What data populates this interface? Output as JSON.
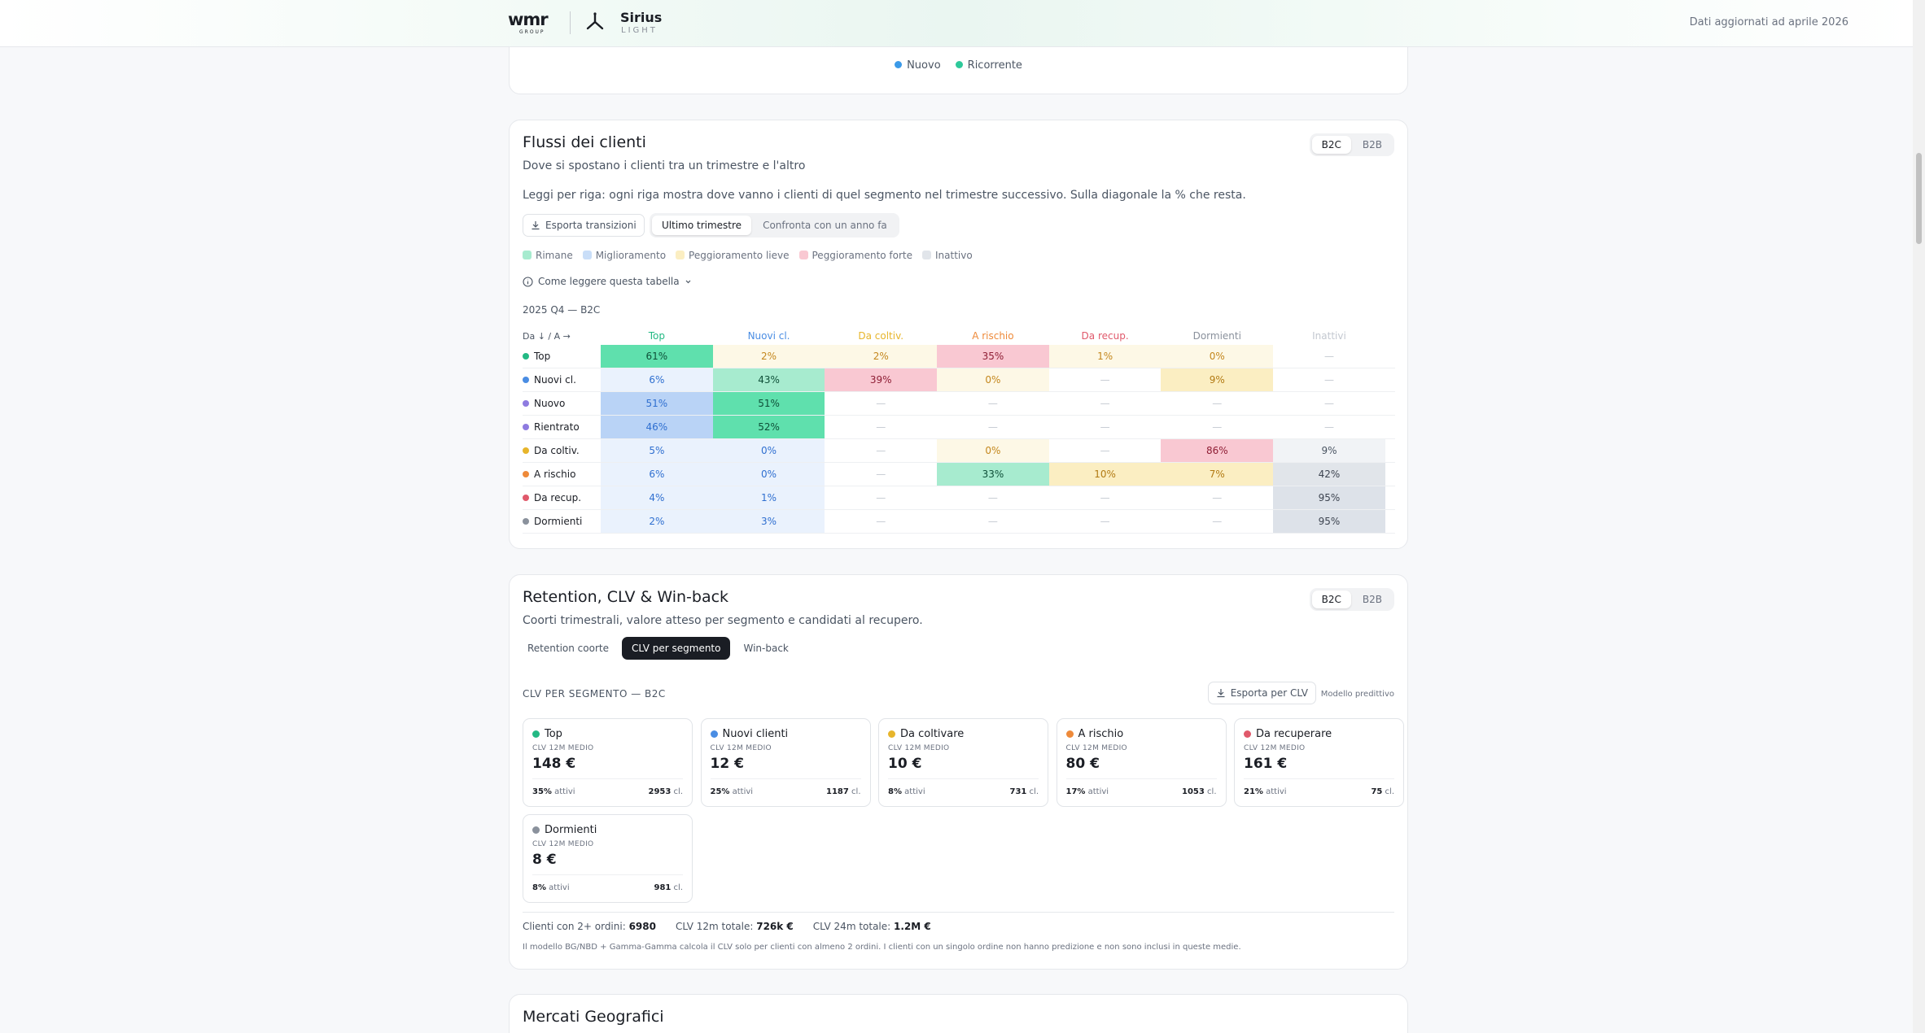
{
  "header": {
    "logo_text": "wmr",
    "logo_sub": "GROUP",
    "app_name": "Sirius",
    "app_sub": "LIGHT",
    "updated": "Dati aggiornati ad aprile 2026"
  },
  "top_legend": [
    {
      "label": "Nuovo",
      "color": "#3b9ae8"
    },
    {
      "label": "Ricorrente",
      "color": "#2ec99a"
    }
  ],
  "flussi": {
    "title": "Flussi dei clienti",
    "subtitle": "Dove si spostano i clienti tra un trimestre e l'altro",
    "toggle": [
      "B2C",
      "B2B"
    ],
    "toggle_active": "B2C",
    "info": "Leggi per riga: ogni riga mostra dove vanno i clienti di quel segmento nel trimestre successivo. Sulla diagonale la % che resta.",
    "export_label": "Esporta transizioni",
    "tabs": [
      "Ultimo trimestre",
      "Confronta con un anno fa"
    ],
    "tab_active": "Ultimo trimestre",
    "legend": [
      {
        "label": "Rimane",
        "color": "#a7ebcf"
      },
      {
        "label": "Miglioramento",
        "color": "#c9def8"
      },
      {
        "label": "Peggioramento lieve",
        "color": "#fbeec2"
      },
      {
        "label": "Peggioramento forte",
        "color": "#f9c8d2"
      },
      {
        "label": "Inattivo",
        "color": "#e1e5ea"
      }
    ],
    "howto": "Come leggere questa tabella",
    "period": "2025 Q4 — B2C",
    "corner": "Da ↓ / A →",
    "columns": [
      {
        "label": "Top",
        "color": "#23b984"
      },
      {
        "label": "Nuovi cl.",
        "color": "#4a8de3"
      },
      {
        "label": "Da coltiv.",
        "color": "#e7b52b"
      },
      {
        "label": "A rischio",
        "color": "#ee8a3a"
      },
      {
        "label": "Da recup.",
        "color": "#e0596b"
      },
      {
        "label": "Dormienti",
        "color": "#8a919c"
      },
      {
        "label": "Inattivi",
        "color": "#c3c8d0"
      }
    ],
    "rows": [
      {
        "label": "Top",
        "dot": "#23b984",
        "cells": [
          {
            "v": "61%",
            "bg": "#5fe0ad",
            "fg": "#0e4f38"
          },
          {
            "v": "2%",
            "bg": "#fdf8e6",
            "fg": "#c4871d"
          },
          {
            "v": "2%",
            "bg": "#fdf8e6",
            "fg": "#c4871d"
          },
          {
            "v": "35%",
            "bg": "#f9c8d2",
            "fg": "#8f1e35"
          },
          {
            "v": "1%",
            "bg": "#fdf8e6",
            "fg": "#c4871d"
          },
          {
            "v": "0%",
            "bg": "#fdf8e6",
            "fg": "#c4871d"
          },
          {
            "v": "—",
            "bg": "",
            "fg": "#c3c8d0"
          }
        ]
      },
      {
        "label": "Nuovi cl.",
        "dot": "#4a8de3",
        "cells": [
          {
            "v": "6%",
            "bg": "#eaf2fd",
            "fg": "#2f6fd0"
          },
          {
            "v": "43%",
            "bg": "#a7ebcf",
            "fg": "#0e4f38"
          },
          {
            "v": "39%",
            "bg": "#f9c8d2",
            "fg": "#8f1e35"
          },
          {
            "v": "0%",
            "bg": "#fdf8e6",
            "fg": "#c4871d"
          },
          {
            "v": "—",
            "bg": "",
            "fg": "#c3c8d0"
          },
          {
            "v": "9%",
            "bg": "#fbeec2",
            "fg": "#b27a13"
          },
          {
            "v": "—",
            "bg": "",
            "fg": "#c3c8d0"
          }
        ]
      },
      {
        "label": "Nuovo",
        "dot": "#8e7be0",
        "cells": [
          {
            "v": "51%",
            "bg": "#b9d3f6",
            "fg": "#2f6fd0"
          },
          {
            "v": "51%",
            "bg": "#5fe0ad",
            "fg": "#0e4f38"
          },
          {
            "v": "—",
            "bg": "",
            "fg": "#c3c8d0"
          },
          {
            "v": "—",
            "bg": "",
            "fg": "#c3c8d0"
          },
          {
            "v": "—",
            "bg": "",
            "fg": "#c3c8d0"
          },
          {
            "v": "—",
            "bg": "",
            "fg": "#c3c8d0"
          },
          {
            "v": "—",
            "bg": "",
            "fg": "#c3c8d0"
          }
        ]
      },
      {
        "label": "Rientrato",
        "dot": "#8e7be0",
        "cells": [
          {
            "v": "46%",
            "bg": "#b9d3f6",
            "fg": "#2f6fd0"
          },
          {
            "v": "52%",
            "bg": "#5fe0ad",
            "fg": "#0e4f38"
          },
          {
            "v": "—",
            "bg": "",
            "fg": "#c3c8d0"
          },
          {
            "v": "—",
            "bg": "",
            "fg": "#c3c8d0"
          },
          {
            "v": "—",
            "bg": "",
            "fg": "#c3c8d0"
          },
          {
            "v": "—",
            "bg": "",
            "fg": "#c3c8d0"
          },
          {
            "v": "—",
            "bg": "",
            "fg": "#c3c8d0"
          }
        ]
      },
      {
        "label": "Da coltiv.",
        "dot": "#e7b52b",
        "cells": [
          {
            "v": "5%",
            "bg": "#eaf2fd",
            "fg": "#2f6fd0"
          },
          {
            "v": "0%",
            "bg": "#eaf2fd",
            "fg": "#2f6fd0"
          },
          {
            "v": "—",
            "bg": "",
            "fg": "#c3c8d0"
          },
          {
            "v": "0%",
            "bg": "#fdf8e6",
            "fg": "#c4871d"
          },
          {
            "v": "—",
            "bg": "",
            "fg": "#c3c8d0"
          },
          {
            "v": "86%",
            "bg": "#f9c8d2",
            "fg": "#8f1e35"
          },
          {
            "v": "9%",
            "bg": "#f1f3f6",
            "fg": "#4b5563"
          }
        ]
      },
      {
        "label": "A rischio",
        "dot": "#ee8a3a",
        "cells": [
          {
            "v": "6%",
            "bg": "#eaf2fd",
            "fg": "#2f6fd0"
          },
          {
            "v": "0%",
            "bg": "#eaf2fd",
            "fg": "#2f6fd0"
          },
          {
            "v": "—",
            "bg": "",
            "fg": "#c3c8d0"
          },
          {
            "v": "33%",
            "bg": "#a7ebcf",
            "fg": "#0e4f38"
          },
          {
            "v": "10%",
            "bg": "#fbeec2",
            "fg": "#b27a13"
          },
          {
            "v": "7%",
            "bg": "#fbeec2",
            "fg": "#b27a13"
          },
          {
            "v": "42%",
            "bg": "#e1e5ea",
            "fg": "#3d4450"
          }
        ]
      },
      {
        "label": "Da recup.",
        "dot": "#e0596b",
        "cells": [
          {
            "v": "4%",
            "bg": "#eaf2fd",
            "fg": "#2f6fd0"
          },
          {
            "v": "1%",
            "bg": "#eaf2fd",
            "fg": "#2f6fd0"
          },
          {
            "v": "—",
            "bg": "",
            "fg": "#c3c8d0"
          },
          {
            "v": "—",
            "bg": "",
            "fg": "#c3c8d0"
          },
          {
            "v": "—",
            "bg": "",
            "fg": "#c3c8d0"
          },
          {
            "v": "—",
            "bg": "",
            "fg": "#c3c8d0"
          },
          {
            "v": "95%",
            "bg": "#dde2e9",
            "fg": "#3d4450"
          }
        ]
      },
      {
        "label": "Dormienti",
        "dot": "#8a919c",
        "cells": [
          {
            "v": "2%",
            "bg": "#eaf2fd",
            "fg": "#2f6fd0"
          },
          {
            "v": "3%",
            "bg": "#eaf2fd",
            "fg": "#2f6fd0"
          },
          {
            "v": "—",
            "bg": "",
            "fg": "#c3c8d0"
          },
          {
            "v": "—",
            "bg": "",
            "fg": "#c3c8d0"
          },
          {
            "v": "—",
            "bg": "",
            "fg": "#c3c8d0"
          },
          {
            "v": "—",
            "bg": "",
            "fg": "#c3c8d0"
          },
          {
            "v": "95%",
            "bg": "#dde2e9",
            "fg": "#3d4450"
          }
        ]
      }
    ]
  },
  "retention": {
    "title": "Retention, CLV & Win-back",
    "subtitle": "Coorti trimestrali, valore atteso per segmento e candidati al recupero.",
    "toggle": [
      "B2C",
      "B2B"
    ],
    "toggle_active": "B2C",
    "tabs": [
      "Retention coorte",
      "CLV per segmento",
      "Win-back"
    ],
    "tab_active": "CLV per segmento",
    "section_label": "CLV PER SEGMENTO — B2C",
    "export_label": "Esporta per CLV",
    "model_label": "Modello predittivo",
    "metric_label": "CLV 12M MEDIO",
    "active_suffix": "attivi",
    "cl_suffix": "cl.",
    "segments": [
      {
        "name": "Top",
        "dot": "#23b984",
        "value": "148 €",
        "active": "35%",
        "clients": "2953"
      },
      {
        "name": "Nuovi clienti",
        "dot": "#4a8de3",
        "value": "12 €",
        "active": "25%",
        "clients": "1187"
      },
      {
        "name": "Da coltivare",
        "dot": "#e7b52b",
        "value": "10 €",
        "active": "8%",
        "clients": "731"
      },
      {
        "name": "A rischio",
        "dot": "#ee8a3a",
        "value": "80 €",
        "active": "17%",
        "clients": "1053"
      },
      {
        "name": "Da recuperare",
        "dot": "#e0596b",
        "value": "161 €",
        "active": "21%",
        "clients": "75"
      },
      {
        "name": "Dormienti",
        "dot": "#8a919c",
        "value": "8 €",
        "active": "8%",
        "clients": "981"
      }
    ],
    "totals": [
      {
        "label": "Clienti con 2+ ordini:",
        "value": "6980"
      },
      {
        "label": "CLV 12m totale:",
        "value": "726k €"
      },
      {
        "label": "CLV 24m totale:",
        "value": "1.2M €"
      }
    ],
    "note": "Il modello BG/NBD + Gamma-Gamma calcola il CLV solo per clienti con almeno 2 ordini. I clienti con un singolo ordine non hanno predizione e non sono inclusi in queste medie."
  },
  "mercati": {
    "title": "Mercati Geografici"
  }
}
